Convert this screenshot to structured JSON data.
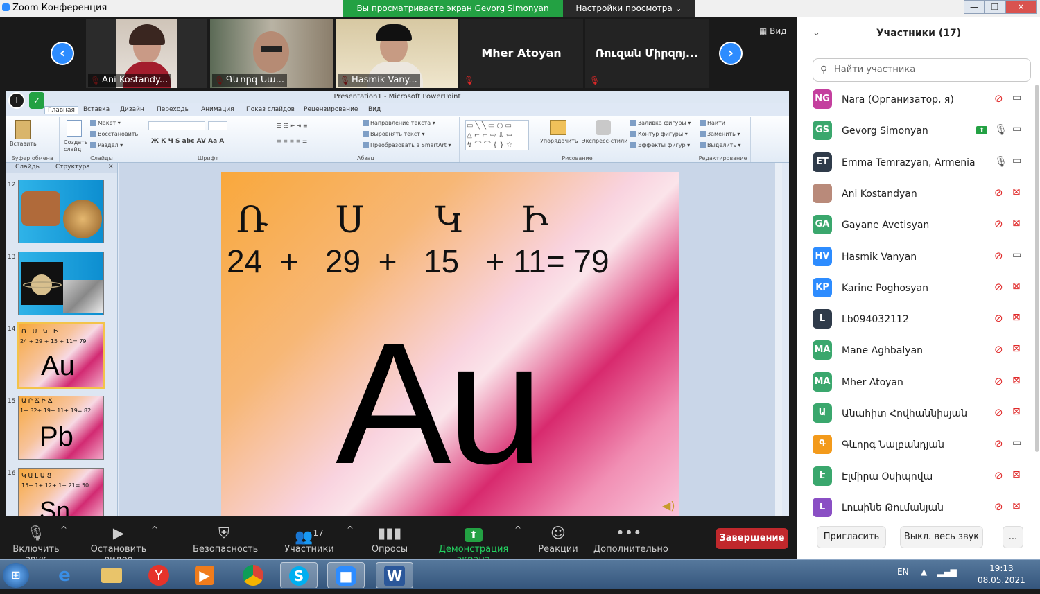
{
  "window": {
    "title": "Zoom Конференция",
    "share_banner": "Вы просматриваете экран Gevorg Simonyan",
    "view_settings": "Настройки просмотра ⌄",
    "minimize": "—",
    "maximize": "❐",
    "close": "✕"
  },
  "videos": [
    {
      "name": "Ani Kostandy...",
      "mic": "🎙"
    },
    {
      "name": "Գևորգ Նա...",
      "mic": "🎙"
    },
    {
      "name": "Hasmik Vany...",
      "mic": "🎙"
    },
    {
      "name": "Mher Atoyan",
      "mic": "🎙"
    },
    {
      "name": "Ռուզան Միրզոյ...",
      "mic": "🎙"
    }
  ],
  "view_button": "Вид",
  "nav": {
    "prev": "‹",
    "next": "›"
  },
  "powerpoint": {
    "title": "Presentation1 - Microsoft PowerPoint",
    "tabs": [
      "Главная",
      "Вставка",
      "Дизайн",
      "Переходы",
      "Анимация",
      "Показ слайдов",
      "Рецензирование",
      "Вид"
    ],
    "groups": [
      "Буфер обмена",
      "Слайды",
      "Шрифт",
      "Абзац",
      "Рисование",
      "Редактирование"
    ],
    "ribbon_items": {
      "paste": "Вставить",
      "new_slide": "Создать слайд",
      "layout": "Макет ▾",
      "reset": "Восстановить",
      "section": "Раздел ▾",
      "text_dir": "Направление текста ▾",
      "align_text": "Выровнять текст ▾",
      "smartart": "Преобразовать в SmartArt ▾",
      "arrange": "Упорядочить",
      "quick_styles": "Экспресс-стили",
      "fill": "Заливка фигуры ▾",
      "outline": "Контур фигуры ▾",
      "effects": "Эффекты фигур ▾",
      "find": "Найти",
      "replace": "Заменить ▾",
      "select": "Выделить ▾"
    },
    "panel_tabs": [
      "Слайды",
      "Структура"
    ],
    "thumbs": [
      {
        "num": "12",
        "line1": "",
        "line2": "",
        "big": ""
      },
      {
        "num": "13",
        "line1": "",
        "line2": "",
        "big": ""
      },
      {
        "num": "14",
        "line1": "Ռ   Ս   Կ   Ի",
        "line2": "24 + 29 + 15 + 11= 79",
        "big": "Au"
      },
      {
        "num": "15",
        "line1": "Ա Ր Ճ Ի Ճ",
        "line2": "1+ 32+ 19+ 11+ 19= 82",
        "big": "Pb"
      },
      {
        "num": "16",
        "line1": "Կ Ա Լ Ա Ց",
        "line2": "15+ 1+ 12+ 1+ 21= 50",
        "big": "Sn"
      }
    ],
    "slide": {
      "letters": [
        "Ռ",
        "Ս",
        "Կ",
        "Ի"
      ],
      "formula": "24  +   29  +   15   + 11= 79",
      "symbol": "Au"
    }
  },
  "sidebar": {
    "title": "Участники (17)",
    "search_placeholder": "Найти участника",
    "participants": [
      {
        "initials": "NG",
        "name": "Nara (Организатор, я)",
        "color": "#c43f9e",
        "mic": "muted",
        "cam": "on"
      },
      {
        "initials": "GS",
        "name": "Gevorg Simonyan",
        "color": "#3aa76d",
        "mic": "on",
        "cam": "on",
        "sharing": true
      },
      {
        "initials": "ET",
        "name": "Emma Temrazyan, Armenia",
        "color": "#2f3b4a",
        "mic": "on",
        "cam": "on"
      },
      {
        "initials": "",
        "name": "Ani Kostandyan",
        "color": "#b98a7a",
        "mic": "muted",
        "cam": "off"
      },
      {
        "initials": "GA",
        "name": "Gayane Avetisyan",
        "color": "#3aa76d",
        "mic": "muted",
        "cam": "off"
      },
      {
        "initials": "HV",
        "name": "Hasmik Vanyan",
        "color": "#2d8cff",
        "mic": "muted",
        "cam": "on"
      },
      {
        "initials": "KP",
        "name": "Karine Poghosyan",
        "color": "#2d8cff",
        "mic": "muted",
        "cam": "off"
      },
      {
        "initials": "L",
        "name": "Lb094032112",
        "color": "#2f3b4a",
        "mic": "muted",
        "cam": "off"
      },
      {
        "initials": "MA",
        "name": "Mane Aghbalyan",
        "color": "#3aa76d",
        "mic": "muted",
        "cam": "off"
      },
      {
        "initials": "MA",
        "name": "Mher Atoyan",
        "color": "#3aa76d",
        "mic": "muted",
        "cam": "off"
      },
      {
        "initials": "Ա",
        "name": "Անահիտ Հովհաննիսյան",
        "color": "#3aa76d",
        "mic": "muted",
        "cam": "off"
      },
      {
        "initials": "Գ",
        "name": "Գևորգ Նալբանդյան",
        "color": "#f39a1b",
        "mic": "muted",
        "cam": "on"
      },
      {
        "initials": "Է",
        "name": "Էլմիրա Օսիպովա",
        "color": "#3aa76d",
        "mic": "muted",
        "cam": "off"
      },
      {
        "initials": "L",
        "name": "Լուսինե Թումանյան",
        "color": "#8a4fc4",
        "mic": "muted",
        "cam": "off"
      }
    ],
    "invite": "Пригласить",
    "mute_all": "Выкл. весь звук",
    "more": "..."
  },
  "toolbar": {
    "unmute": "Включить звук",
    "stop_video": "Остановить видео",
    "security": "Безопасность",
    "participants": "Участники",
    "participants_count": "17",
    "polls": "Опросы",
    "share": "Демонстрация экрана",
    "reactions": "Реакции",
    "more": "Дополнительно",
    "end": "Завершение"
  },
  "taskbar": {
    "lang": "EN",
    "time": "19:13",
    "date": "08.05.2021"
  },
  "colors": {
    "zoom_blue": "#2d8cff",
    "share_green": "#23a143",
    "end_red": "#c0282c",
    "muted_red": "#e02828"
  }
}
